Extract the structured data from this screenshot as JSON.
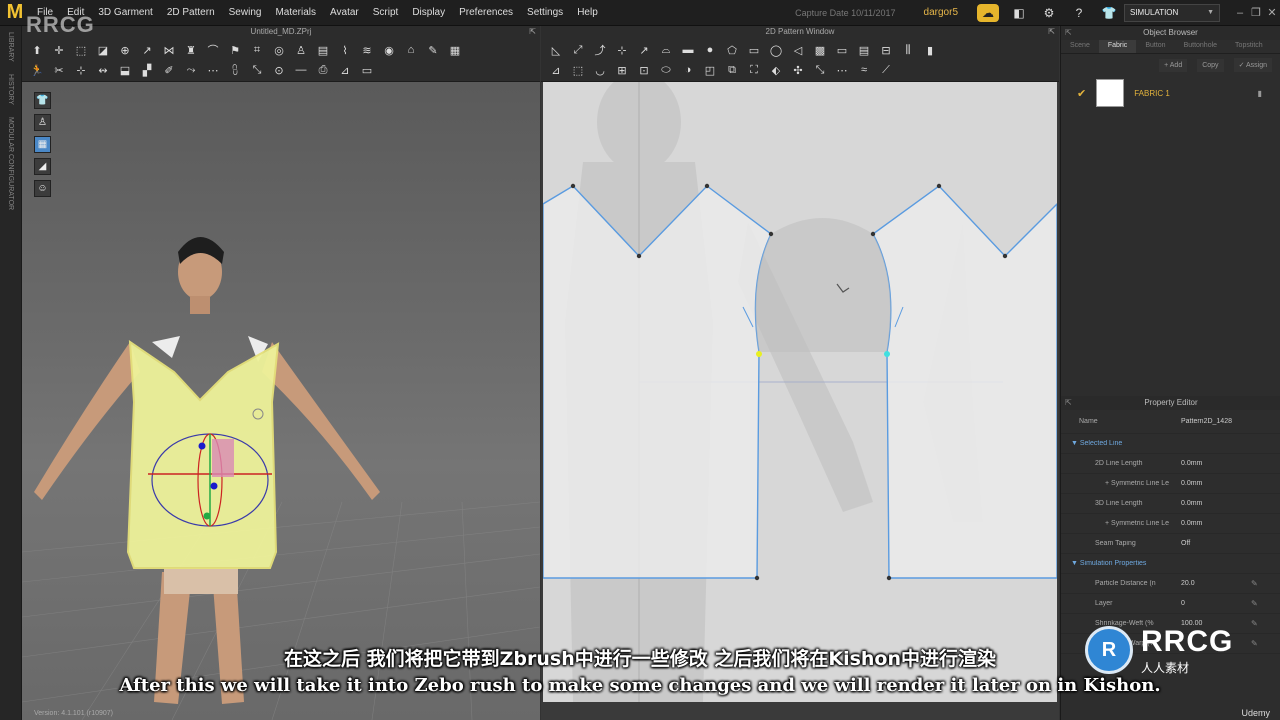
{
  "menu": {
    "logo": "M",
    "items": [
      "File",
      "Edit",
      "3D Garment",
      "2D Pattern",
      "Sewing",
      "Materials",
      "Avatar",
      "Script",
      "Display",
      "Preferences",
      "Settings",
      "Help"
    ],
    "capture_date": "Capture Date 10/11/2017",
    "user": "dargor5",
    "simulation": "SIMULATION"
  },
  "left_strip": [
    "LIBRARY",
    "HISTORY",
    "MODULAR CONFIGURATOR"
  ],
  "window_3d": {
    "title": "Untitled_MD.ZPrj",
    "version": "Version: 4.1.101 (r10907)"
  },
  "window_2d": {
    "title": "2D Pattern Window"
  },
  "object_browser": {
    "title": "Object Browser",
    "tabs": [
      "Scene",
      "Fabric",
      "Button",
      "Buttonhole",
      "Topstitch"
    ],
    "active_tab": "Fabric",
    "actions": [
      "+ Add",
      "Copy",
      "✓ Assign"
    ],
    "fabric": {
      "name": "FABRIC 1"
    }
  },
  "property_editor": {
    "title": "Property Editor",
    "name_label": "Name",
    "name_value": "Pattern2D_1428",
    "rows": [
      {
        "type": "section",
        "label": "Selected Line",
        "value": ""
      },
      {
        "type": "row",
        "label": "2D Line Length",
        "value": "0.0mm"
      },
      {
        "type": "row2",
        "label": "+ Symmetric Line Le",
        "value": "0.0mm"
      },
      {
        "type": "row",
        "label": "3D Line Length",
        "value": "0.0mm"
      },
      {
        "type": "row2",
        "label": "+ Symmetric Line Le",
        "value": "0.0mm"
      },
      {
        "type": "row",
        "label": "Seam Taping",
        "value": "Off"
      },
      {
        "type": "section",
        "label": "Simulation Properties",
        "value": ""
      },
      {
        "type": "row",
        "label": "Particle Distance (n",
        "value": "20.0"
      },
      {
        "type": "row",
        "label": "Layer",
        "value": "0"
      },
      {
        "type": "row",
        "label": "Shrinkage-Weft (%",
        "value": "100.00"
      },
      {
        "type": "row",
        "label": "Shrinkage-Warp (%",
        "value": ""
      }
    ]
  },
  "subtitles": {
    "cn": "在这之后 我们将把它带到Zbrush中进行一些修改 之后我们将在Kishon中进行渲染",
    "en": "After this we will take it into Zebo rush to make some changes and we will render it later on in Kishon."
  },
  "watermark": {
    "top": "RRCG",
    "brand": "RRCG",
    "site": "人人素材",
    "udemy": "Udemy"
  },
  "colors": {
    "accent": "#e6b52c",
    "pattern_line": "#4a90d9",
    "garment": "#eef29a",
    "section_text": "#6fa9e0"
  }
}
